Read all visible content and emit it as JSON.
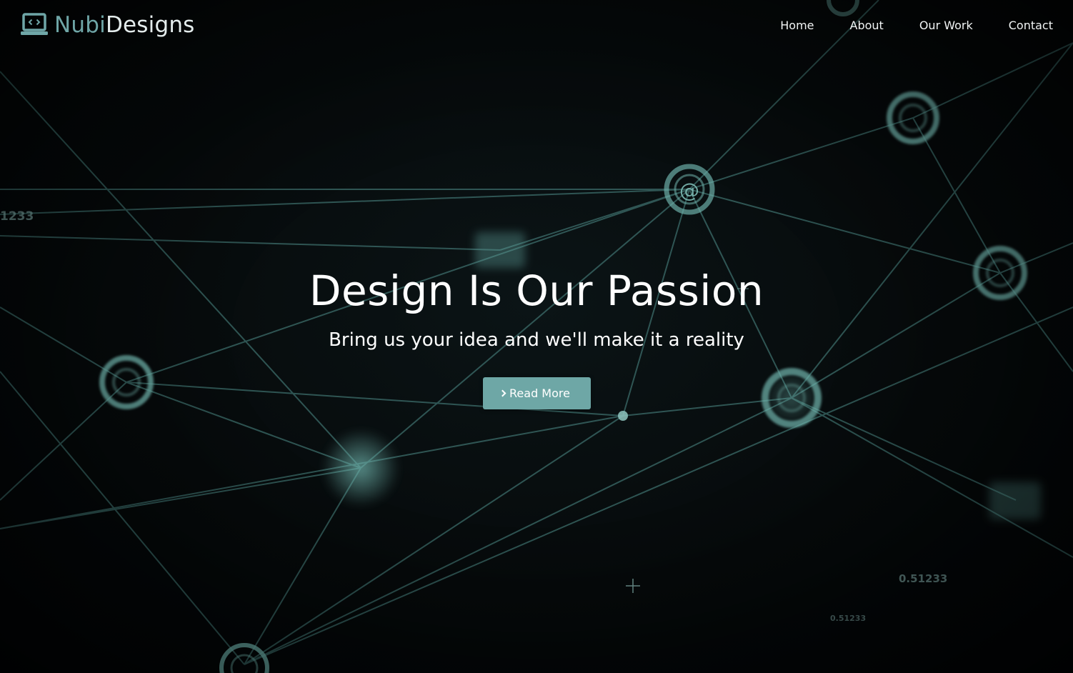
{
  "brand": {
    "part1": "Nubi",
    "part2": "Designs",
    "icon": "laptop-code-icon"
  },
  "nav": {
    "items": [
      {
        "label": "Home"
      },
      {
        "label": "About"
      },
      {
        "label": "Our Work"
      },
      {
        "label": "Contact"
      }
    ]
  },
  "hero": {
    "title": "Design Is Our Passion",
    "subtitle": "Bring us your idea and we'll make it a reality",
    "cta_label": "Read More",
    "cta_icon": "chevron-right-icon"
  },
  "background": {
    "numbers": [
      "1233",
      "0.51233",
      "0.51233"
    ],
    "node_symbol": "@"
  },
  "colors": {
    "accent": "#6ea7a6",
    "brand_light": "#6fa6a7",
    "background": "#040708",
    "network_line": "#5a9a96"
  }
}
